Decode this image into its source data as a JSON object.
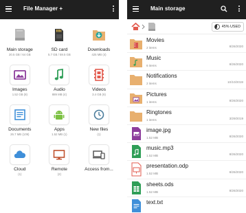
{
  "left": {
    "title": "File Manager +",
    "grid": [
      {
        "label": "Main storage",
        "sub": "20.5 GB / 64 GB",
        "icon": "phone-storage-icon"
      },
      {
        "label": "SD card",
        "sub": "5.7 GB / 59.5 GB",
        "icon": "sd-card-icon"
      },
      {
        "label": "Downloads",
        "sub": "425 MB (4)",
        "icon": "download-folder-icon"
      },
      {
        "label": "Images",
        "sub": "1.52 GB (8)",
        "icon": "image-icon"
      },
      {
        "label": "Audio",
        "sub": "889 MB (4)",
        "icon": "music-note-icon"
      },
      {
        "label": "Videos",
        "sub": "3.4 GB (6)",
        "icon": "film-strip-icon"
      },
      {
        "label": "Documents",
        "sub": "26.7 MB (109)",
        "icon": "document-icon"
      },
      {
        "label": "Apps",
        "sub": "1.52 MB (1)",
        "icon": "android-icon"
      },
      {
        "label": "New files",
        "sub": "(1)",
        "icon": "clock-icon"
      },
      {
        "label": "Cloud",
        "sub": "(1)",
        "icon": "cloud-icon"
      },
      {
        "label": "Remote",
        "sub": "(2)",
        "icon": "monitor-icon"
      },
      {
        "label": "Access from...",
        "sub": "",
        "icon": "devices-icon"
      }
    ]
  },
  "right": {
    "title": "Main storage",
    "used_badge": "45% USED",
    "files": [
      {
        "name": "Movies",
        "meta": "2 items",
        "date": "8/26/2020",
        "icon": "film-folder-icon"
      },
      {
        "name": "Music",
        "meta": "6 items",
        "date": "8/26/2020",
        "icon": "music-folder-icon"
      },
      {
        "name": "Notifications",
        "meta": "2 items",
        "date": "10/10/2019",
        "icon": "folder-icon"
      },
      {
        "name": "Pictures",
        "meta": "1 items",
        "date": "8/26/2020",
        "icon": "picture-folder-icon"
      },
      {
        "name": "Ringtones",
        "meta": "1 items",
        "date": "3/29/2019",
        "icon": "folder-icon"
      },
      {
        "name": "image.jpg",
        "meta": "1.52 MB",
        "date": "8/26/2020",
        "icon": "image-file-icon"
      },
      {
        "name": "music.mp3",
        "meta": "1.52 MB",
        "date": "8/26/2020",
        "icon": "audio-file-icon"
      },
      {
        "name": "presentation.odp",
        "meta": "1.52 MB",
        "date": "8/26/2020",
        "icon": "presentation-file-icon"
      },
      {
        "name": "sheets.ods",
        "meta": "1.52 MB",
        "date": "8/26/2020",
        "icon": "spreadsheet-file-icon"
      },
      {
        "name": "text.txt",
        "meta": "",
        "date": "",
        "icon": "text-file-icon"
      }
    ]
  },
  "colors": {
    "appbar": "#202020",
    "folder": "#e8b06f",
    "accent_red": "#e25b4f",
    "accent_blue": "#3f8fd9",
    "accent_green": "#2f9e57",
    "accent_purple": "#8d3d9c",
    "accent_orange": "#ef8a2a"
  }
}
